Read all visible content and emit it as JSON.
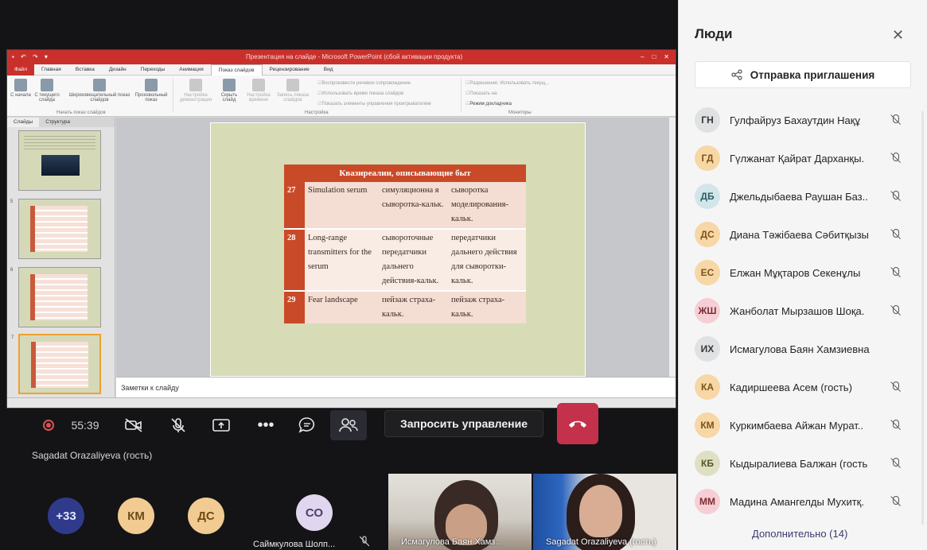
{
  "ppt": {
    "title_doc": "Презентация на слайде - Microsoft PowerPoint (сбой активации продукта)",
    "window_buttons": [
      "–",
      "□",
      "✕"
    ],
    "tabs": [
      "Файл",
      "Главная",
      "Вставка",
      "Дизайн",
      "Переходы",
      "Анимация",
      "Показ слайдов",
      "Рецензирование",
      "Вид"
    ],
    "ribbon": {
      "start_begin": "С начала",
      "start_current": "С текущего слайда",
      "broadcast": "Широковещательный показ слайдов",
      "custom_show": "Произвольный показ",
      "group_start": "Начать показ слайдов",
      "setup": "Настройка демонстрации",
      "hide": "Скрыть слайд",
      "rehearse": "Настройка времени",
      "record": "Запись показа слайдов",
      "chk1": "Воспроизвести речевое сопровождение",
      "chk2": "Использовать время показа слайдов",
      "chk3": "Показать элементы управления проигрывателем",
      "group_setup": "Настройка",
      "resolution": "Разрешение: Использовать текущ...",
      "show_on": "Показать на:",
      "presenter_view": "Режим докладчика",
      "group_monitors": "Мониторы"
    },
    "panel_tabs": [
      "Слайды",
      "Структура"
    ],
    "thumb_numbers": [
      "",
      "5",
      "6",
      "7"
    ],
    "notes_placeholder": "Заметки к слайду"
  },
  "slide": {
    "table_header": "Квазиреалии, описывающие быт",
    "rows": [
      {
        "n": "27",
        "en": "Simulation serum",
        "ru1": "симуляционна я сыворотка-кальк.",
        "ru2": "сыворотка моделирования-кальк."
      },
      {
        "n": "28",
        "en": "Long-range transmitters for the serum",
        "ru1": "сывороточные передатчики дальнего действия-кальк.",
        "ru2": "передатчики дальнего действия для сыворотки-кальк."
      },
      {
        "n": "29",
        "en": "Fear landscape",
        "ru1": "пейзаж страха-кальк.",
        "ru2": "пейзаж страха-кальк."
      }
    ]
  },
  "controls": {
    "timer": "55:39",
    "request_control": "Запросить управление"
  },
  "presenter_name": "Sagadat Orazaliyeva (гость)",
  "bottom": {
    "more_count": "+33",
    "km": "КМ",
    "ds": "ДС",
    "so": "СО",
    "so_name": "Саймкулова Шолп...",
    "tile1_name": "Исмагулова Баян Хамз...",
    "tile2_name": "Sagadat Orazaliyeva (гость)"
  },
  "people": {
    "title": "Люди",
    "invite_label": "Отправка приглашения",
    "list": [
      {
        "initials": "ГН",
        "name": "Гулфайруз Бахаутдин Нақұ",
        "color": "gray"
      },
      {
        "initials": "ГД",
        "name": "Гүлжанат Қайрат Дарханқы.",
        "color": "yellow"
      },
      {
        "initials": "ДБ",
        "name": "Джельдыбаева Раушан Баз..",
        "color": "teal"
      },
      {
        "initials": "ДС",
        "name": "Диана Тәжібаева Сәбитқызы",
        "color": "yellow"
      },
      {
        "initials": "ЕС",
        "name": "Елжан Мұқтаров Секенұлы",
        "color": "yellow"
      },
      {
        "initials": "ЖШ",
        "name": "Жанболат Мырзашов Шоқа.",
        "color": "pink"
      },
      {
        "initials": "ИХ",
        "name": "Исмагулова Баян Хамзиевна",
        "color": "gray"
      },
      {
        "initials": "КА",
        "name": "Кадиршеева Асем (гость)",
        "color": "yellow"
      },
      {
        "initials": "КМ",
        "name": "Куркимбаева Айжан Мурат..",
        "color": "yellow"
      },
      {
        "initials": "КБ",
        "name": "Кыдыралиева Балжан (гость",
        "color": "olive"
      },
      {
        "initials": "ММ",
        "name": "Мадина Амангелды Мухитқ.",
        "color": "pink"
      }
    ],
    "more": "Дополнительно (14)"
  }
}
